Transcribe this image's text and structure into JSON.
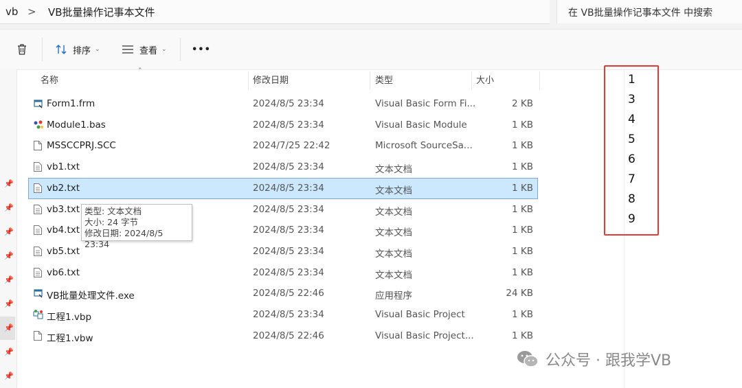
{
  "address": {
    "root": "vb",
    "separator": ">",
    "current": "VB批量操作记事本文件"
  },
  "search": {
    "placeholder": "在 VB批量操作记事本文件 中搜索"
  },
  "toolbar": {
    "sort_label": "排序",
    "view_label": "查看",
    "more_label": "•••"
  },
  "columns": {
    "name": "名称",
    "date": "修改日期",
    "type": "类型",
    "size": "大小"
  },
  "files": [
    {
      "name": "Form1.frm",
      "date": "2024/8/5 23:34",
      "type": "Visual Basic Form Fi...",
      "size": "2 KB",
      "icon": "vb-form-icon"
    },
    {
      "name": "Module1.bas",
      "date": "2024/8/5 23:34",
      "type": "Visual Basic Module",
      "size": "1 KB",
      "icon": "vb-module-icon"
    },
    {
      "name": "MSSCCPRJ.SCC",
      "date": "2024/7/25 22:42",
      "type": "Microsoft SourceSa...",
      "size": "1 KB",
      "icon": "blank-file-icon"
    },
    {
      "name": "vb1.txt",
      "date": "2024/8/5 23:34",
      "type": "文本文档",
      "size": "1 KB",
      "icon": "text-file-icon"
    },
    {
      "name": "vb2.txt",
      "date": "2024/8/5 23:34",
      "type": "文本文档",
      "size": "1 KB",
      "icon": "text-file-icon",
      "selected": true
    },
    {
      "name": "vb3.txt",
      "date": "2024/8/5 23:34",
      "type": "文本文档",
      "size": "1 KB",
      "icon": "text-file-icon"
    },
    {
      "name": "vb4.txt",
      "date": "2024/8/5 23:34",
      "type": "文本文档",
      "size": "1 KB",
      "icon": "text-file-icon"
    },
    {
      "name": "vb5.txt",
      "date": "2024/8/5 23:34",
      "type": "文本文档",
      "size": "1 KB",
      "icon": "text-file-icon"
    },
    {
      "name": "vb6.txt",
      "date": "2024/8/5 23:34",
      "type": "文本文档",
      "size": "1 KB",
      "icon": "text-file-icon"
    },
    {
      "name": "VB批量处理文件.exe",
      "date": "2024/8/5 22:46",
      "type": "应用程序",
      "size": "24 KB",
      "icon": "exe-icon"
    },
    {
      "name": "工程1.vbp",
      "date": "2024/8/5 23:34",
      "type": "Visual Basic Project",
      "size": "1 KB",
      "icon": "vb-project-icon"
    },
    {
      "name": "工程1.vbw",
      "date": "2024/8/5 22:46",
      "type": "Visual Basic Project...",
      "size": "1 KB",
      "icon": "blank-file-icon"
    }
  ],
  "tooltip": {
    "line1": "类型: 文本文档",
    "line2": "大小: 24 字节",
    "line3": "修改日期: 2024/8/5 23:34"
  },
  "preview_numbers": [
    "1",
    "3",
    "4",
    "5",
    "6",
    "7",
    "8",
    "9"
  ],
  "watermark": {
    "text": "公众号 · 跟我学VB"
  },
  "colors": {
    "selection": "#cce8ff",
    "highlight_box": "#e53935"
  }
}
